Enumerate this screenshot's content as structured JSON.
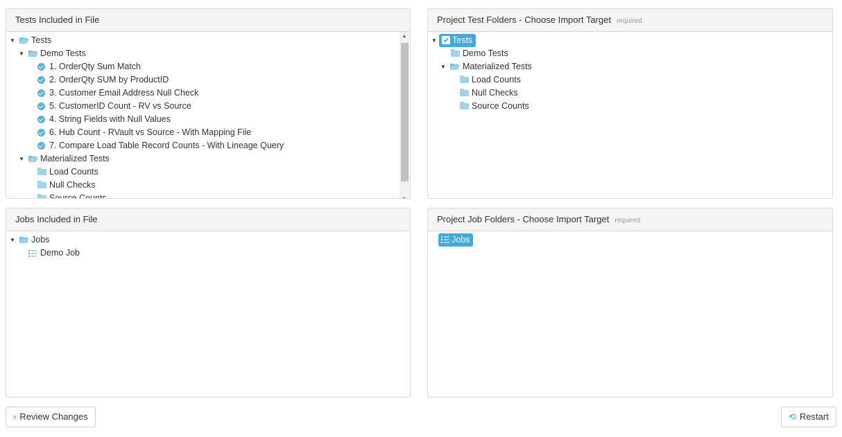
{
  "tests_file": {
    "title": "Tests Included in File",
    "root": "Tests",
    "demo_folder": "Demo Tests",
    "tests": [
      "1. OrderQty Sum Match",
      "2. OrderQty SUM by ProductID",
      "3. Customer Email Address Null Check",
      "5. CustomerID Count - RV vs Source",
      "4. String Fields with Null Values",
      "6. Hub Count - RVault vs Source - With Mapping File",
      "7. Compare Load Table Record Counts - With Lineage Query"
    ],
    "materialized_folder": "Materialized Tests",
    "materialized_children": [
      "Load Counts",
      "Null Checks",
      "Source Counts"
    ]
  },
  "project_tests": {
    "title": "Project Test Folders - Choose Import Target",
    "required": "required",
    "root": "Tests",
    "demo_folder": "Demo Tests",
    "materialized_folder": "Materialized Tests",
    "materialized_children": [
      "Load Counts",
      "Null Checks",
      "Source Counts"
    ]
  },
  "jobs_file": {
    "title": "Jobs Included in File",
    "root": "Jobs",
    "jobs": [
      "Demo Job"
    ]
  },
  "project_jobs": {
    "title": "Project Job Folders - Choose Import Target",
    "required": "required",
    "root": "Jobs"
  },
  "buttons": {
    "review": "Review Changes",
    "restart": "Restart"
  },
  "colors": {
    "accent": "#3fa9e0",
    "folder": "#9fd3ec",
    "check": "#5bb3dc"
  }
}
